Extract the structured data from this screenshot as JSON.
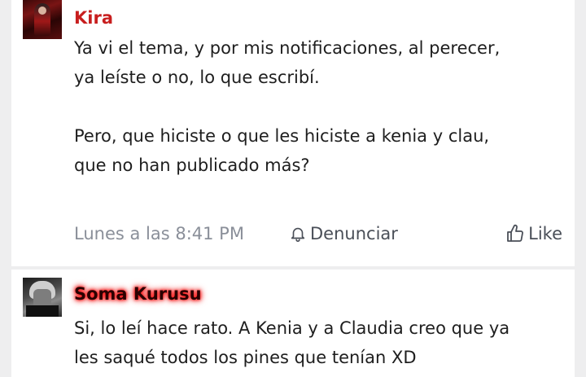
{
  "comments": [
    {
      "username": "Kira",
      "message": "Ya vi el tema, y por mis notificaciones, al perecer,\nya leíste o no, lo que escribí.\n\nPero, que hiciste o que les hiciste a kenia y clau,\nque no han publicado más?",
      "timestamp": "Lunes a las 8:41 PM",
      "report_label": "Denunciar",
      "like_label": "Like",
      "avatar_icon": "user-avatar-icon"
    },
    {
      "username": "Soma Kurusu",
      "message": "Si, lo leí hace rato. A Kenia y a Claudia creo que ya\nles saqué todos los pines que tenían XD",
      "avatar_icon": "user-avatar-icon"
    }
  ],
  "colors": {
    "background": "#eeeeef",
    "card": "#ffffff",
    "kira_name": "#c81e1e",
    "soma_glow": "#ff1a1a",
    "meta_text": "#8a8f99"
  },
  "icons": {
    "report": "bell-icon",
    "like": "thumbs-up-icon"
  }
}
